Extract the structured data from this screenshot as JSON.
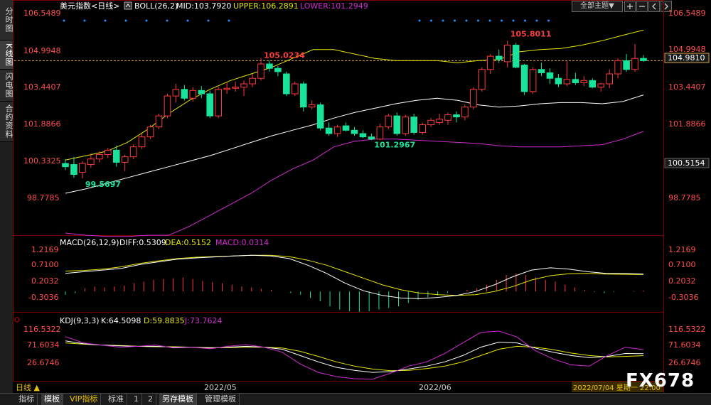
{
  "sidebar": {
    "tabs": [
      "分时图",
      "K线图",
      "闪电图",
      "合约资料"
    ],
    "active": 1
  },
  "toolbar": {
    "theme_select": "全部主题",
    "arrow_down": "▼"
  },
  "main_panel": {
    "header": {
      "symbol": "美元指数<日线>",
      "indicator": "BOLL(26,2)",
      "mid_label": "MID:103.7920",
      "upper_label": "UPPER:106.2891",
      "lower_label": "LOWER:101.2949"
    },
    "price_labels": [
      "106.5489",
      "104.9948",
      "103.4407",
      "101.8866",
      "100.3325",
      "98.7785"
    ],
    "current_price_label": "104.9810",
    "right_tag_label": "100.5154",
    "annotations": {
      "high1": "105.0234",
      "high2": "105.8011",
      "low1": "99.5697",
      "low2": "101.2967"
    }
  },
  "macd_panel": {
    "header": {
      "name": "MACD(26,12,9)",
      "diff": "DIFF:0.5309",
      "dea": "DEA:0.5152",
      "macd": "MACD:0.0314"
    },
    "labels": [
      "1.2169",
      "0.7100",
      "0.2032",
      "-0.3036"
    ]
  },
  "kdj_panel": {
    "header": {
      "name": "KDJ(9,3,3)",
      "k": "K:64.5098",
      "d": "D:59.8835",
      "j": "J:73.7624"
    },
    "labels": [
      "116.5322",
      "71.6034",
      "26.6746"
    ]
  },
  "x_axis": {
    "ticks": [
      "2022/05",
      "2022/06"
    ],
    "cursor_date": "2022/07/04 星期一 22:00",
    "period": "日线 ▲"
  },
  "bottom_tabs": [
    "指标",
    "模板",
    "VIP指标",
    "标准",
    "1",
    "2",
    "另存模板",
    "管理模板"
  ],
  "watermark": "FX678",
  "colors": {
    "up": "#ff3b3b",
    "down": "#19e39a",
    "upper": "#e6e600",
    "mid": "#ffffff",
    "lower": "#d02bd0",
    "dea": "#e6e600",
    "diff": "#ffffff"
  },
  "chart_data": {
    "type": "candlestick",
    "title": "美元指数<日线>",
    "y_range": [
      98.0,
      107.0
    ],
    "candles": [
      {
        "o": 100.25,
        "h": 100.45,
        "l": 99.95,
        "c": 100.1
      },
      {
        "o": 100.2,
        "h": 100.55,
        "l": 99.6,
        "c": 99.75
      },
      {
        "o": 99.85,
        "h": 100.35,
        "l": 99.57,
        "c": 100.25
      },
      {
        "o": 100.2,
        "h": 100.7,
        "l": 100.05,
        "c": 100.45
      },
      {
        "o": 100.45,
        "h": 100.8,
        "l": 100.3,
        "c": 100.65
      },
      {
        "o": 100.65,
        "h": 100.95,
        "l": 100.5,
        "c": 100.85
      },
      {
        "o": 100.85,
        "h": 101.05,
        "l": 100.1,
        "c": 100.3
      },
      {
        "o": 100.3,
        "h": 100.65,
        "l": 99.9,
        "c": 100.55
      },
      {
        "o": 100.55,
        "h": 101.1,
        "l": 100.45,
        "c": 101.0
      },
      {
        "o": 101.0,
        "h": 101.6,
        "l": 100.9,
        "c": 101.45
      },
      {
        "o": 101.45,
        "h": 102.0,
        "l": 101.35,
        "c": 101.9
      },
      {
        "o": 101.9,
        "h": 102.5,
        "l": 101.8,
        "c": 102.4
      },
      {
        "o": 102.4,
        "h": 103.4,
        "l": 102.3,
        "c": 103.3
      },
      {
        "o": 103.3,
        "h": 103.85,
        "l": 103.0,
        "c": 103.6
      },
      {
        "o": 103.6,
        "h": 103.8,
        "l": 103.1,
        "c": 103.2
      },
      {
        "o": 103.2,
        "h": 103.7,
        "l": 103.05,
        "c": 103.55
      },
      {
        "o": 103.55,
        "h": 103.75,
        "l": 103.2,
        "c": 103.4
      },
      {
        "o": 103.4,
        "h": 103.55,
        "l": 102.3,
        "c": 102.4
      },
      {
        "o": 102.4,
        "h": 103.7,
        "l": 102.3,
        "c": 103.6
      },
      {
        "o": 103.6,
        "h": 103.9,
        "l": 103.4,
        "c": 103.65
      },
      {
        "o": 103.65,
        "h": 103.95,
        "l": 103.5,
        "c": 103.7
      },
      {
        "o": 103.7,
        "h": 104.0,
        "l": 103.3,
        "c": 103.85
      },
      {
        "o": 103.85,
        "h": 104.3,
        "l": 103.7,
        "c": 104.1
      },
      {
        "o": 104.1,
        "h": 105.02,
        "l": 104.0,
        "c": 104.75
      },
      {
        "o": 104.75,
        "h": 104.9,
        "l": 104.4,
        "c": 104.55
      },
      {
        "o": 104.55,
        "h": 104.65,
        "l": 104.2,
        "c": 104.4
      },
      {
        "o": 104.3,
        "h": 104.4,
        "l": 103.3,
        "c": 103.4
      },
      {
        "o": 103.4,
        "h": 103.95,
        "l": 103.3,
        "c": 103.85
      },
      {
        "o": 103.85,
        "h": 103.95,
        "l": 102.6,
        "c": 102.8
      },
      {
        "o": 102.8,
        "h": 103.1,
        "l": 102.7,
        "c": 102.9
      },
      {
        "o": 102.9,
        "h": 103.0,
        "l": 101.75,
        "c": 101.85
      },
      {
        "o": 101.85,
        "h": 102.1,
        "l": 101.5,
        "c": 101.6
      },
      {
        "o": 101.6,
        "h": 102.0,
        "l": 101.45,
        "c": 101.9
      },
      {
        "o": 101.95,
        "h": 102.1,
        "l": 101.7,
        "c": 101.75
      },
      {
        "o": 101.75,
        "h": 101.9,
        "l": 101.5,
        "c": 101.6
      },
      {
        "o": 101.6,
        "h": 101.75,
        "l": 101.4,
        "c": 101.45
      },
      {
        "o": 101.45,
        "h": 101.6,
        "l": 101.3,
        "c": 101.35
      },
      {
        "o": 101.35,
        "h": 102.05,
        "l": 101.3,
        "c": 101.9
      },
      {
        "o": 101.9,
        "h": 102.5,
        "l": 101.8,
        "c": 102.4
      },
      {
        "o": 102.4,
        "h": 102.55,
        "l": 101.5,
        "c": 101.6
      },
      {
        "o": 101.6,
        "h": 102.45,
        "l": 101.5,
        "c": 102.35
      },
      {
        "o": 102.35,
        "h": 102.5,
        "l": 101.55,
        "c": 101.65
      },
      {
        "o": 101.65,
        "h": 102.1,
        "l": 101.55,
        "c": 102.0
      },
      {
        "o": 102.0,
        "h": 102.3,
        "l": 101.9,
        "c": 102.2
      },
      {
        "o": 102.1,
        "h": 102.5,
        "l": 102.0,
        "c": 102.25
      },
      {
        "o": 102.2,
        "h": 102.55,
        "l": 102.0,
        "c": 102.45
      },
      {
        "o": 102.45,
        "h": 102.6,
        "l": 102.1,
        "c": 102.35
      },
      {
        "o": 102.35,
        "h": 102.9,
        "l": 102.2,
        "c": 102.8
      },
      {
        "o": 102.8,
        "h": 103.7,
        "l": 102.7,
        "c": 103.6
      },
      {
        "o": 103.6,
        "h": 104.6,
        "l": 103.5,
        "c": 104.5
      },
      {
        "o": 104.5,
        "h": 105.2,
        "l": 104.3,
        "c": 105.1
      },
      {
        "o": 105.1,
        "h": 105.4,
        "l": 104.8,
        "c": 104.95
      },
      {
        "o": 104.85,
        "h": 105.8,
        "l": 104.6,
        "c": 105.6
      },
      {
        "o": 105.6,
        "h": 105.7,
        "l": 104.55,
        "c": 104.6
      },
      {
        "o": 104.7,
        "h": 104.75,
        "l": 103.35,
        "c": 103.5
      },
      {
        "o": 103.5,
        "h": 104.6,
        "l": 103.4,
        "c": 104.5
      },
      {
        "o": 104.5,
        "h": 104.8,
        "l": 104.2,
        "c": 104.35
      },
      {
        "o": 104.35,
        "h": 104.55,
        "l": 103.85,
        "c": 104.1
      },
      {
        "o": 104.1,
        "h": 104.3,
        "l": 103.7,
        "c": 103.85
      },
      {
        "o": 103.85,
        "h": 104.9,
        "l": 103.75,
        "c": 104.05
      },
      {
        "o": 104.05,
        "h": 104.35,
        "l": 103.8,
        "c": 103.9
      },
      {
        "o": 103.9,
        "h": 104.2,
        "l": 103.75,
        "c": 104.0
      },
      {
        "o": 104.0,
        "h": 104.1,
        "l": 103.65,
        "c": 103.7
      },
      {
        "o": 103.7,
        "h": 103.9,
        "l": 103.5,
        "c": 103.85
      },
      {
        "o": 103.85,
        "h": 104.5,
        "l": 103.65,
        "c": 104.3
      },
      {
        "o": 104.3,
        "h": 105.0,
        "l": 104.1,
        "c": 104.9
      },
      {
        "o": 104.9,
        "h": 105.2,
        "l": 104.4,
        "c": 104.5
      },
      {
        "o": 104.5,
        "h": 105.65,
        "l": 104.4,
        "c": 105.0
      },
      {
        "o": 105.0,
        "h": 105.15,
        "l": 104.85,
        "c": 104.9
      }
    ],
    "boll": {
      "mid": [
        98.9,
        99.1,
        99.35,
        99.6,
        99.85,
        100.1,
        100.35,
        100.6,
        100.9,
        101.2,
        101.5,
        101.75,
        102.0,
        102.3,
        102.55,
        102.75,
        102.95,
        103.1,
        103.2,
        103.1,
        102.9,
        102.8,
        102.85,
        102.95,
        103.0,
        103.0,
        102.95,
        103.05,
        103.35
      ],
      "upper": [
        100.4,
        100.6,
        100.8,
        101.2,
        101.8,
        102.5,
        103.1,
        103.6,
        104.0,
        104.3,
        104.6,
        105.0,
        105.4,
        105.4,
        105.2,
        105.0,
        104.9,
        104.9,
        104.9,
        104.8,
        104.9,
        104.95,
        105.3,
        105.4,
        105.45,
        105.6,
        105.8,
        106.05,
        106.28
      ],
      "lower": [
        97.1,
        97.0,
        96.95,
        96.95,
        97.0,
        97.0,
        97.4,
        97.9,
        98.4,
        98.9,
        99.5,
        100.0,
        100.4,
        101.0,
        101.25,
        101.35,
        101.35,
        101.3,
        101.25,
        101.2,
        101.15,
        101.05,
        101.0,
        101.0,
        101.0,
        101.05,
        101.1,
        101.35,
        101.7
      ]
    },
    "macd": {
      "y_range": [
        -0.6,
        1.3
      ],
      "diff": [
        0.55,
        0.6,
        0.65,
        0.7,
        0.82,
        0.9,
        0.98,
        1.02,
        1.05,
        1.08,
        1.1,
        1.08,
        1.0,
        0.8,
        0.55,
        0.25,
        0.02,
        -0.12,
        -0.2,
        -0.22,
        -0.18,
        -0.12,
        0.0,
        0.2,
        0.45,
        0.65,
        0.72,
        0.68,
        0.6,
        0.55,
        0.55,
        0.53
      ],
      "dea": [
        0.62,
        0.64,
        0.68,
        0.75,
        0.85,
        0.93,
        1.0,
        1.04,
        1.06,
        1.08,
        1.1,
        1.1,
        1.06,
        0.95,
        0.8,
        0.6,
        0.4,
        0.2,
        0.05,
        -0.05,
        -0.1,
        -0.12,
        -0.1,
        0.0,
        0.15,
        0.35,
        0.48,
        0.54,
        0.55,
        0.53,
        0.52,
        0.515
      ],
      "hist": [
        -0.1,
        -0.05,
        0.1,
        0.15,
        0.12,
        0.15,
        0.18,
        0.25,
        0.3,
        0.35,
        0.38,
        0.4,
        0.42,
        0.38,
        0.32,
        0.28,
        0.25,
        0.2,
        0.15,
        0.12,
        0.08,
        0.05,
        0.0,
        -0.05,
        -0.1,
        -0.2,
        -0.3,
        -0.45,
        -0.55,
        -0.6,
        -0.62,
        -0.6,
        -0.55,
        -0.5,
        -0.45,
        -0.35,
        -0.25,
        -0.18,
        -0.12,
        -0.05,
        0.0,
        0.05,
        0.1,
        0.2,
        0.35,
        0.5,
        0.55,
        0.5,
        0.42,
        0.35,
        0.3,
        0.2,
        0.12,
        0.05,
        -0.02,
        -0.05,
        -0.02,
        0.0,
        0.02,
        0.03
      ]
    },
    "kdj": {
      "y_range": [
        0,
        140
      ],
      "k": [
        95,
        88,
        85,
        83,
        82,
        82,
        80,
        80,
        78,
        80,
        82,
        80,
        75,
        60,
        45,
        32,
        25,
        20,
        22,
        28,
        35,
        45,
        60,
        80,
        92,
        90,
        78,
        68,
        60,
        55,
        58,
        65,
        64.5
      ],
      "d": [
        90,
        87,
        85,
        84,
        82,
        81,
        81,
        80,
        79,
        79,
        80,
        80,
        78,
        70,
        58,
        45,
        35,
        28,
        24,
        25,
        29,
        35,
        45,
        60,
        75,
        82,
        80,
        74,
        66,
        60,
        57,
        58,
        59.9
      ],
      "j": [
        105,
        90,
        85,
        80,
        82,
        85,
        78,
        80,
        76,
        82,
        86,
        80,
        68,
        40,
        20,
        10,
        5,
        4,
        18,
        35,
        45,
        65,
        90,
        115,
        118,
        104,
        72,
        52,
        38,
        35,
        60,
        80,
        73.8
      ]
    }
  }
}
